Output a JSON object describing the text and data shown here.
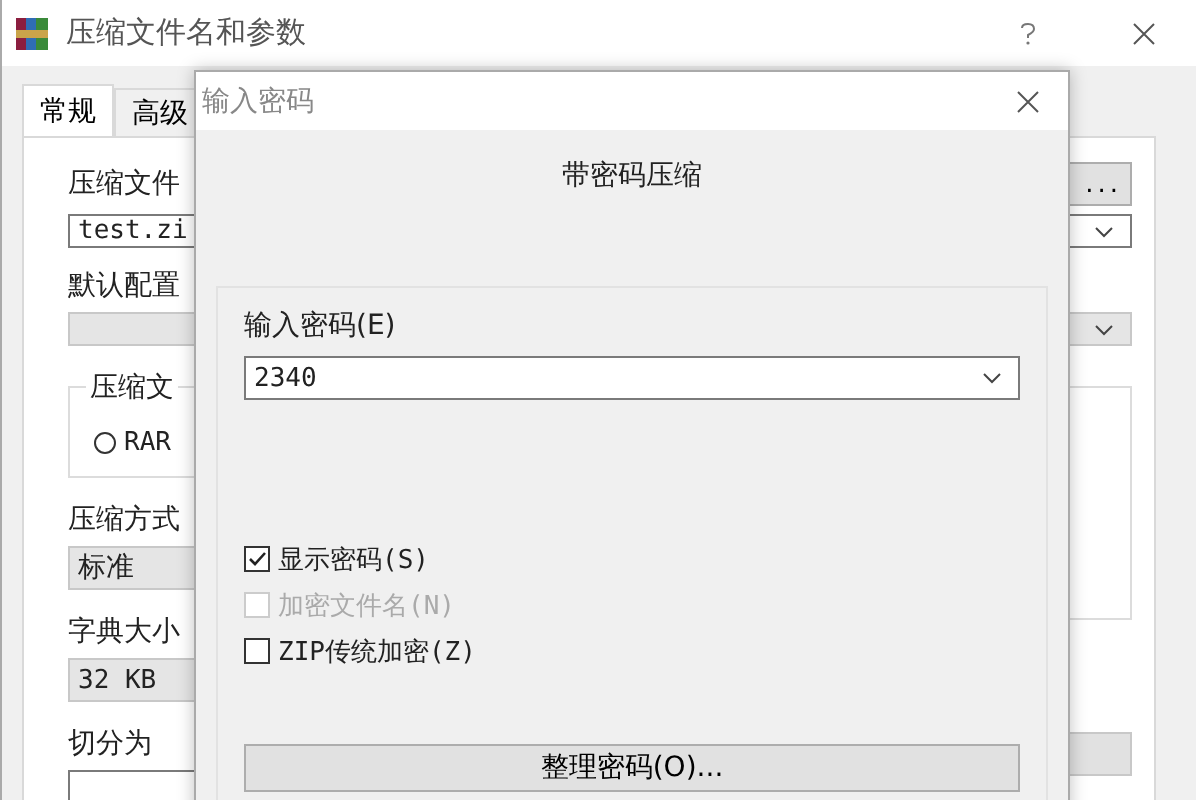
{
  "window": {
    "title": "压缩文件名和参数"
  },
  "tabs": [
    {
      "label": "常规",
      "selected": true
    },
    {
      "label": "高级",
      "selected": false
    }
  ],
  "archive_name": {
    "label": "压缩文件",
    "browse_button": "...",
    "value": "test.zi"
  },
  "profile": {
    "label": "默认配置"
  },
  "format_group": {
    "legend": "压缩文",
    "options": [
      {
        "label": "RAR",
        "selected": false
      }
    ]
  },
  "method": {
    "label": "压缩方式",
    "value": "标准"
  },
  "dictionary": {
    "label": "字典大小",
    "value": "32 KB"
  },
  "split": {
    "label": "切分为"
  },
  "dialog": {
    "title": "输入密码",
    "heading": "带密码压缩",
    "password_label": "输入密码(E)",
    "password_value": "2340",
    "options": [
      {
        "label": "显示密码(S)",
        "checked": true,
        "disabled": false
      },
      {
        "label": "加密文件名(N)",
        "checked": false,
        "disabled": true
      },
      {
        "label": "ZIP传统加密(Z)",
        "checked": false,
        "disabled": false
      }
    ],
    "organize_button": "整理密码(O)..."
  }
}
